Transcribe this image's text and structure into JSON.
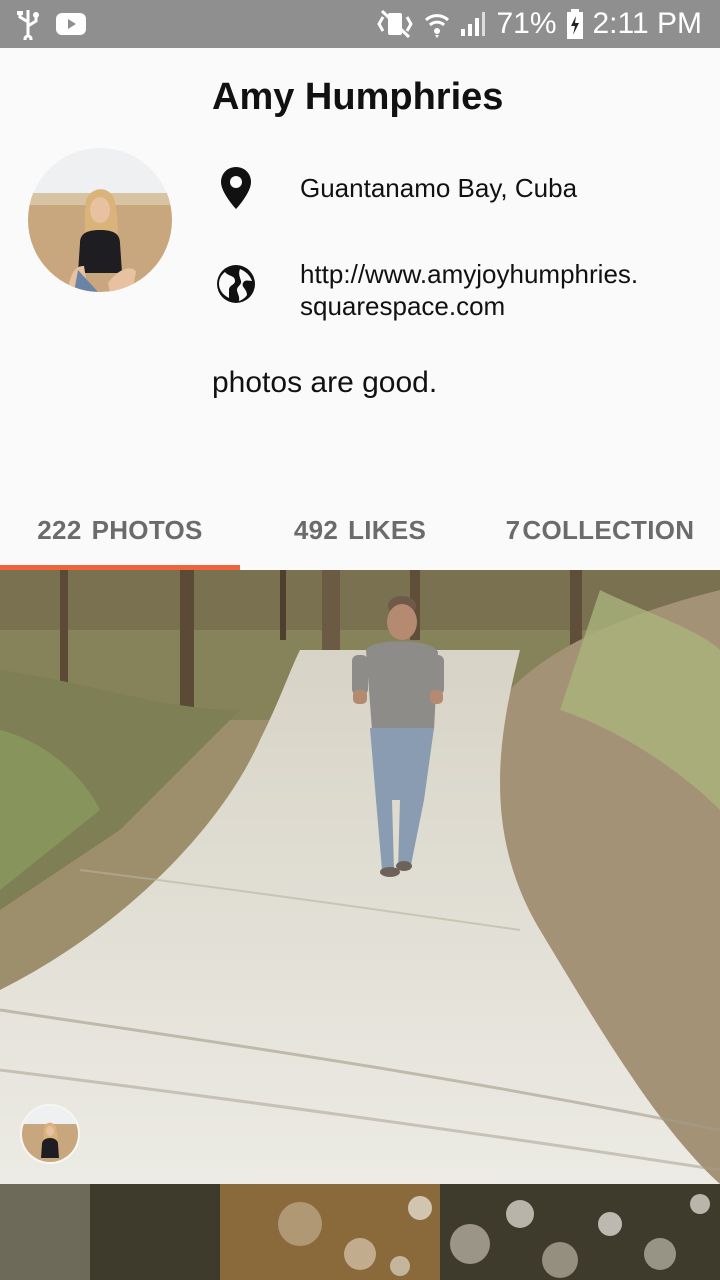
{
  "status_bar": {
    "battery": "71%",
    "time": "2:11 PM",
    "icons": [
      "usb-icon",
      "youtube-icon",
      "vibrate-icon",
      "wifi-icon",
      "signal-icon",
      "battery-charging-icon"
    ]
  },
  "profile": {
    "name": "Amy Humphries",
    "location": "Guantanamo Bay, Cuba",
    "website_line1": "http://www.amyjoyhumphries.",
    "website_line2": "squarespace.com",
    "bio": "photos are good.",
    "location_icon": "location-pin-icon",
    "website_icon": "globe-icon"
  },
  "tabs": [
    {
      "count": "222",
      "label": "PHOTOS",
      "active": true
    },
    {
      "count": "492",
      "label": "LIKES",
      "active": false
    },
    {
      "count": "7",
      "label": "COLLECTION",
      "active": false
    }
  ],
  "colors": {
    "accent": "#f0643c",
    "status_bar": "#8f8f8f",
    "tab_text": "#6b6b6b"
  }
}
